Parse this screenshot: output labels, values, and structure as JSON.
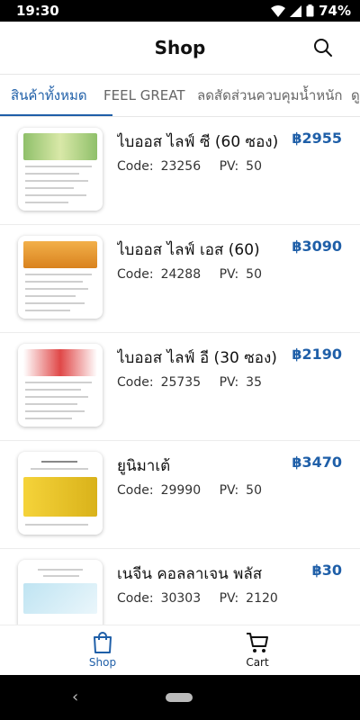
{
  "status_bar": {
    "time": "19:30",
    "battery": "74%"
  },
  "header": {
    "title": "Shop"
  },
  "tabs": [
    {
      "label": "สินค้าทั้งหมด",
      "active": true
    },
    {
      "label": "FEEL GREAT",
      "active": false
    },
    {
      "label": "ลดสัดส่วนควบคุมน้ำหนัก",
      "active": false
    },
    {
      "label": "ดู",
      "active": false
    }
  ],
  "products": [
    {
      "name": "ไบออส ไลฟ์ ซี (60 ซอง)",
      "price": "฿2955",
      "code_label": "Code:",
      "code": "23256",
      "pv_label": "PV:",
      "pv": "50"
    },
    {
      "name": "ไบออส ไลฟ์ เอส (60)",
      "price": "฿3090",
      "code_label": "Code:",
      "code": "24288",
      "pv_label": "PV:",
      "pv": "50"
    },
    {
      "name": "ไบออส ไลฟ์ อี (30 ซอง)",
      "price": "฿2190",
      "code_label": "Code:",
      "code": "25735",
      "pv_label": "PV:",
      "pv": "35"
    },
    {
      "name": "ยูนิมาเต้",
      "price": "฿3470",
      "code_label": "Code:",
      "code": "29990",
      "pv_label": "PV:",
      "pv": "50"
    },
    {
      "name": "เนจีน คอลลาเจน พลัส",
      "price": "฿30",
      "code_label": "Code:",
      "code": "30303",
      "pv_label": "PV:",
      "pv": "2120"
    }
  ],
  "bottom_nav": {
    "shop_label": "Shop",
    "cart_label": "Cart"
  },
  "colors": {
    "accent": "#1f5fa8",
    "text": "#111111",
    "muted": "#666666"
  }
}
